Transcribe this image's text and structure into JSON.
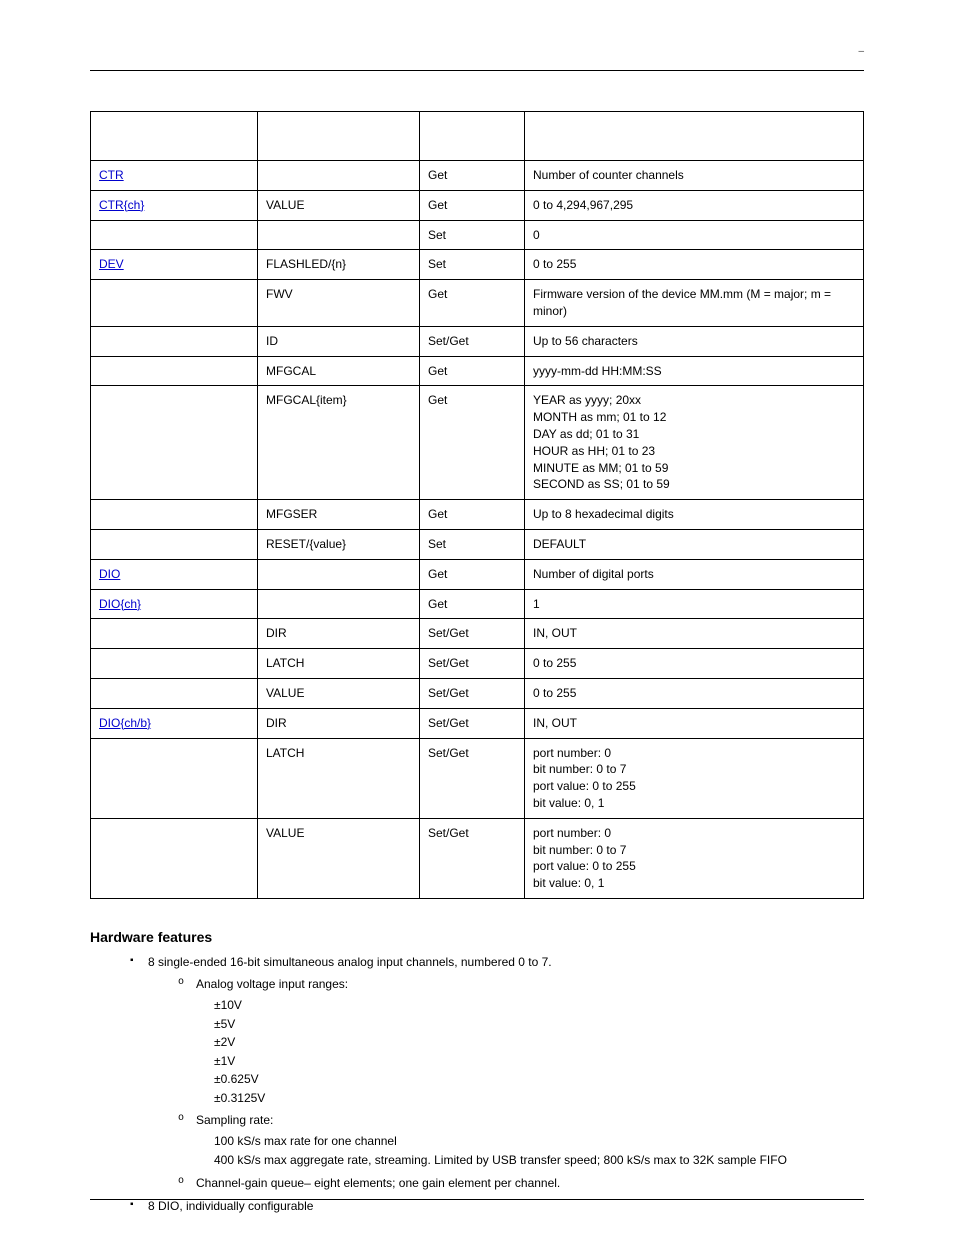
{
  "header": {
    "right_marker": "–"
  },
  "table": {
    "headers": [
      "",
      "",
      "",
      ""
    ],
    "rows": [
      {
        "comp": "CTR",
        "comp_link": true,
        "prop": "",
        "sg": "Get",
        "val": "Number of counter channels"
      },
      {
        "comp": "CTR{ch}",
        "comp_link": true,
        "prop": "VALUE",
        "sg": "Get",
        "val": "0 to 4,294,967,295"
      },
      {
        "comp": "",
        "prop": "",
        "sg": "Set",
        "val": "0"
      },
      {
        "comp": "DEV",
        "comp_link": true,
        "prop": "FLASHLED/{n}",
        "sg": "Set",
        "val": "0 to 255"
      },
      {
        "comp": "",
        "prop": "FWV",
        "sg": "Get",
        "val": "Firmware version of the device MM.mm (M = major; m = minor)"
      },
      {
        "comp": "",
        "prop": "ID",
        "sg": "Set/Get",
        "val": "Up to 56 characters"
      },
      {
        "comp": "",
        "prop": "MFGCAL",
        "sg": "Get",
        "val": "yyyy-mm-dd HH:MM:SS"
      },
      {
        "comp": "",
        "prop": "MFGCAL{item}",
        "sg": "Get",
        "val": "YEAR as yyyy; 20xx\nMONTH as mm; 01 to 12\nDAY as dd; 01 to 31\nHOUR as HH; 01 to 23\nMINUTE as MM; 01 to 59\nSECOND as SS; 01 to 59"
      },
      {
        "comp": "",
        "prop": "MFGSER",
        "sg": "Get",
        "val": "Up to 8 hexadecimal digits"
      },
      {
        "comp": "",
        "prop": "RESET/{value}",
        "sg": "Set",
        "val": "DEFAULT"
      },
      {
        "comp": "DIO",
        "comp_link": true,
        "prop": "",
        "sg": "Get",
        "val": "Number of digital ports"
      },
      {
        "comp": "DIO{ch}",
        "comp_link": true,
        "prop": "",
        "sg": "Get",
        "val": "1"
      },
      {
        "comp": "",
        "prop": "DIR",
        "sg": "Set/Get",
        "val": "IN, OUT"
      },
      {
        "comp": "",
        "prop": "LATCH",
        "sg": "Set/Get",
        "val": "0 to 255"
      },
      {
        "comp": "",
        "prop": "VALUE",
        "sg": "Set/Get",
        "val": "0 to 255"
      },
      {
        "comp": "DIO{ch/b}",
        "comp_link": true,
        "prop": "DIR",
        "sg": "Set/Get",
        "val": "IN, OUT"
      },
      {
        "comp": "",
        "prop": "LATCH",
        "sg": "Set/Get",
        "val": "port number: 0\nbit number: 0 to 7\nport value: 0 to 255\nbit value: 0, 1"
      },
      {
        "comp": "",
        "prop": "VALUE",
        "sg": "Set/Get",
        "val": "port number: 0\nbit number: 0 to 7\nport value: 0 to 255\nbit value: 0, 1"
      }
    ]
  },
  "hardware": {
    "title": "Hardware features",
    "items": [
      {
        "text": "8 single-ended 16-bit simultaneous analog input channels, numbered 0 to 7.",
        "subs": [
          {
            "text": "Analog voltage input ranges:",
            "vals": [
              "±10V",
              "±5V",
              "±2V",
              "±1V",
              "±0.625V",
              "±0.3125V"
            ]
          },
          {
            "text": "Sampling rate:",
            "vals": [
              "100 kS/s max rate for one channel",
              "400 kS/s max aggregate rate, streaming. Limited by USB transfer speed; 800 kS/s max to 32K sample FIFO"
            ]
          },
          {
            "text": "Channel-gain queue– eight elements; one gain element per channel."
          }
        ]
      },
      {
        "text": "8 DIO, individually configurable"
      }
    ]
  }
}
